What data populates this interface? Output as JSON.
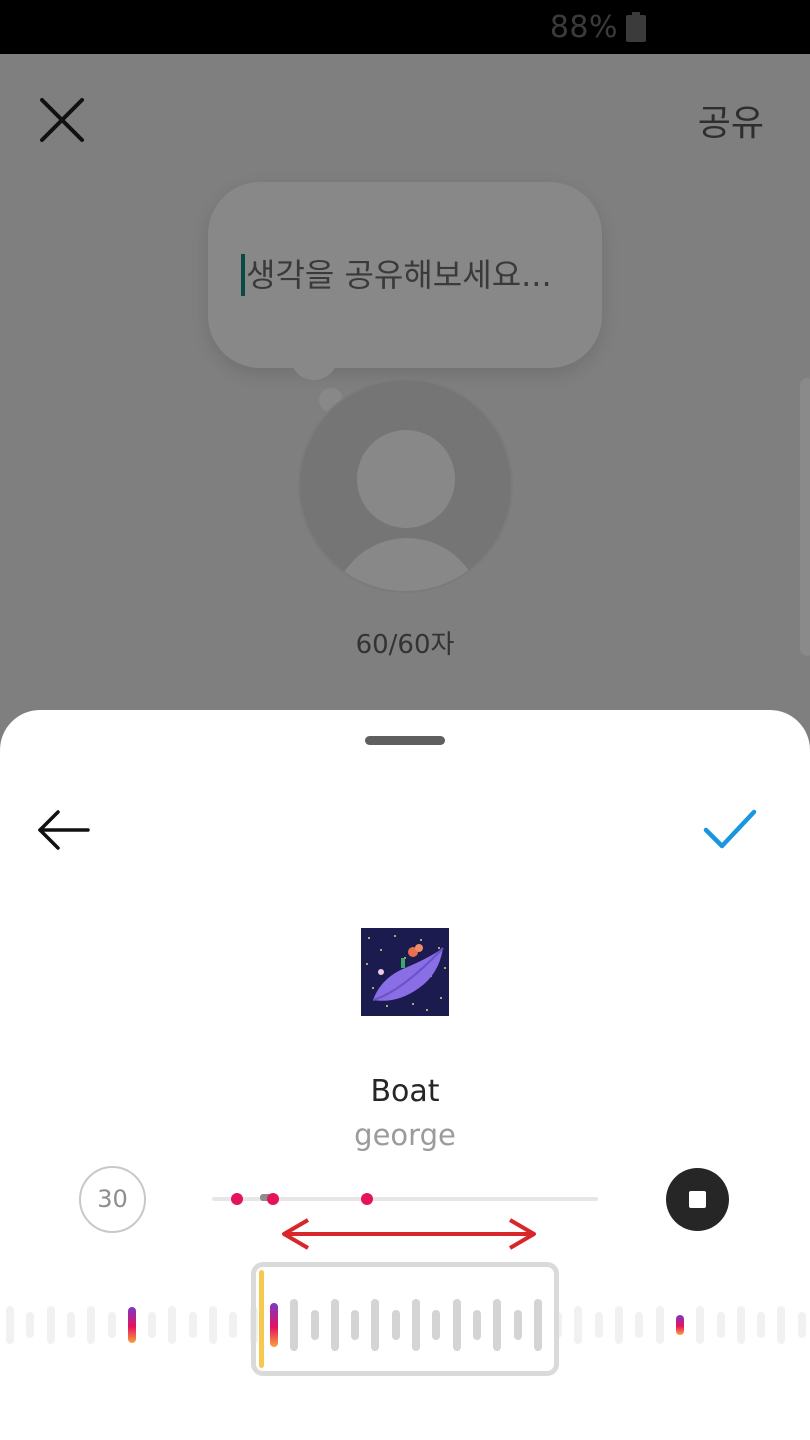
{
  "status_bar": {
    "battery_percent": "88%",
    "battery_icon": "battery-icon"
  },
  "composer": {
    "close_icon": "close-icon",
    "share_label": "공유",
    "note_placeholder": "생각을 공유해보세요...",
    "avatar_icon": "default-avatar-icon",
    "char_count": "60/60자"
  },
  "music_sheet": {
    "back_icon": "arrow-left-icon",
    "confirm_icon": "checkmark-icon",
    "confirm_color": "#1a95e0",
    "track": {
      "title": "Boat",
      "artist": "george",
      "album_art": "album-art-boat"
    },
    "clip_duration": "30",
    "stop_icon": "stop-icon",
    "accent_colors": {
      "markers": "#e5125f",
      "playhead": "#f7c84e",
      "range_arrow": "#d9262b"
    }
  }
}
